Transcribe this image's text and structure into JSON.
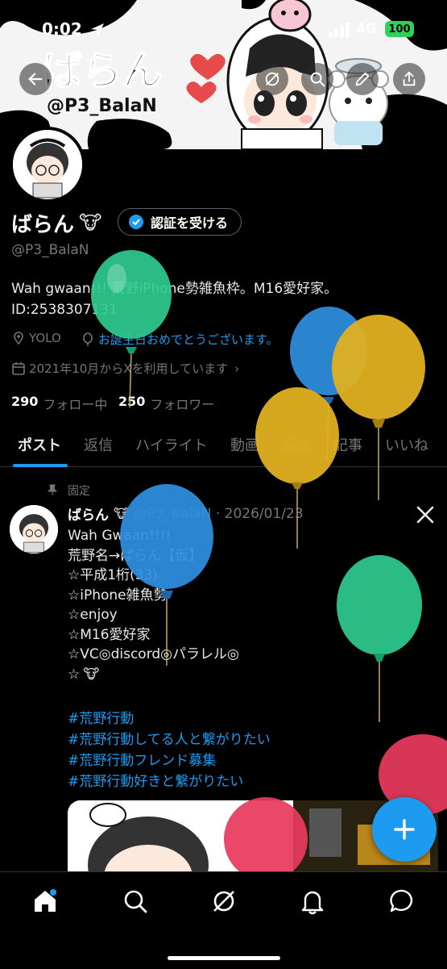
{
  "status_bar": {
    "time": "0:02",
    "network": "4G",
    "battery": "100"
  },
  "banner": {
    "title_art": "ばらん",
    "subtitle_art": "@P3_BalaN"
  },
  "profile": {
    "display_name": "ばらん",
    "verify_button_label": "認証を受ける",
    "handle": "@P3_BalaN",
    "bio_line1": "Wah gwaan!!! 荒野iPhone勢雑魚枠。M16愛好家。",
    "bio_line2": "ID:2538307131",
    "location": "YOLO",
    "birthday": "お誕生日おめでとうございます。",
    "joined": "2021年10月からXを利用しています",
    "following_count": "290",
    "following_label": "フォロー中",
    "followers_count": "250",
    "followers_label": "フォロワー"
  },
  "tabs": [
    "ポスト",
    "返信",
    "ハイライト",
    "動画",
    "画像",
    "記事",
    "いいね"
  ],
  "pinned_label": "固定",
  "post": {
    "author": "ばらん",
    "handle_date": "@P3_BalaN · 2026/01/23",
    "lines": [
      "Wah Gwaan!!!!",
      "荒野名→ばらん【仮】",
      "☆平成1桁(33)",
      "☆iPhone雑魚勢",
      "☆enjoy",
      "☆M16愛好家",
      "☆VC◎discord◎パラレル◎",
      "☆"
    ],
    "hashtags": [
      "#荒野行動",
      "#荒野行動してる人と繋がりたい",
      "#荒野行動フレンド募集",
      "#荒野行動好きと繋がりたい"
    ]
  },
  "colors": {
    "accent": "#1d9bf0",
    "background": "#000000",
    "muted": "#71767b",
    "balloon_green": "#2ecc8f",
    "balloon_blue": "#2f8fe0",
    "balloon_yellow": "#e0b020",
    "balloon_red": "#e83a5c"
  },
  "icons": [
    "back-icon",
    "grok-icon",
    "search-icon",
    "edit-icon",
    "share-icon",
    "verified-icon",
    "location-icon",
    "balloon-icon",
    "calendar-icon",
    "pin-icon",
    "x-logo-icon",
    "home-icon",
    "explore-icon",
    "grok-nav-icon",
    "bell-icon",
    "messages-icon",
    "plus-icon"
  ]
}
